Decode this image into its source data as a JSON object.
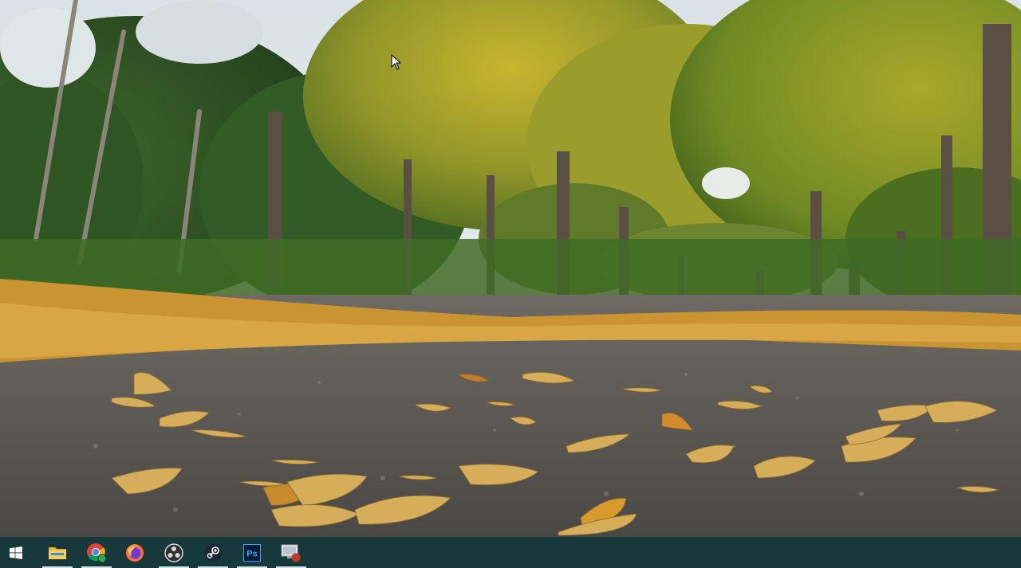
{
  "desktop": {
    "wallpaper": "autumn-park-path-with-fallen-leaves"
  },
  "taskbar": {
    "color": "#17393b",
    "indicator_color": "#cfe3e6",
    "items": [
      {
        "id": "start",
        "icon": "windows-logo-icon",
        "active": false
      },
      {
        "id": "file-explorer",
        "icon": "folder-icon",
        "active": true
      },
      {
        "id": "chrome",
        "icon": "chrome-icon",
        "active": true
      },
      {
        "id": "firefox",
        "icon": "firefox-icon",
        "active": false
      },
      {
        "id": "obs",
        "icon": "obs-icon",
        "active": true
      },
      {
        "id": "steam",
        "icon": "steam-icon",
        "active": true
      },
      {
        "id": "photoshop",
        "icon": "photoshop-icon",
        "label": "Ps",
        "active": true
      },
      {
        "id": "remote-desktop",
        "icon": "monitor-record-icon",
        "active": true
      }
    ]
  }
}
